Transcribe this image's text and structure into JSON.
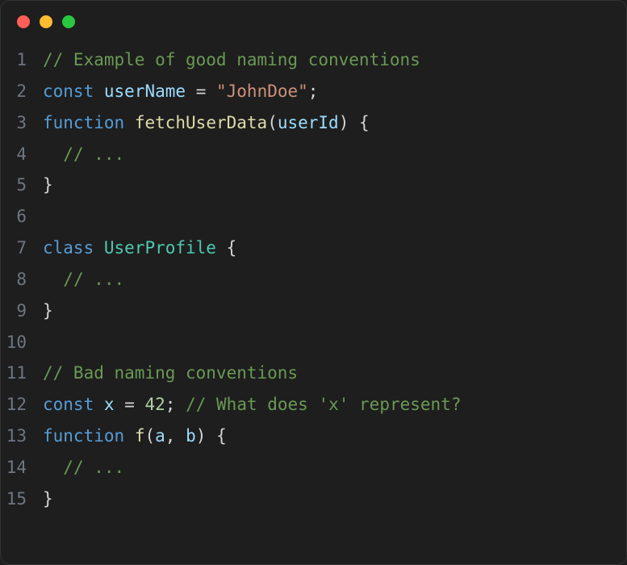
{
  "colors": {
    "background": "#1e1e1e",
    "gutter": "#6e7681",
    "comment": "#6a9955",
    "keyword": "#569cd6",
    "identifier": "#9cdcfe",
    "function": "#dcdcaa",
    "string": "#ce9178",
    "number": "#b5cea8",
    "class": "#4ec9b0",
    "punct": "#d4d4d4",
    "traffic_red": "#ff5f57",
    "traffic_yellow": "#febc2e",
    "traffic_green": "#28c840"
  },
  "lines": [
    {
      "num": "1",
      "tokens": [
        {
          "t": "// Example of good naming conventions",
          "c": "comment"
        }
      ]
    },
    {
      "num": "2",
      "tokens": [
        {
          "t": "const",
          "c": "keyword"
        },
        {
          "t": " ",
          "c": "punct"
        },
        {
          "t": "userName",
          "c": "ident"
        },
        {
          "t": " ",
          "c": "punct"
        },
        {
          "t": "=",
          "c": "operator"
        },
        {
          "t": " ",
          "c": "punct"
        },
        {
          "t": "\"JohnDoe\"",
          "c": "string"
        },
        {
          "t": ";",
          "c": "punct"
        }
      ]
    },
    {
      "num": "3",
      "tokens": [
        {
          "t": "function",
          "c": "keyword"
        },
        {
          "t": " ",
          "c": "punct"
        },
        {
          "t": "fetchUserData",
          "c": "func"
        },
        {
          "t": "(",
          "c": "punct"
        },
        {
          "t": "userId",
          "c": "param"
        },
        {
          "t": ")",
          "c": "punct"
        },
        {
          "t": " ",
          "c": "punct"
        },
        {
          "t": "{",
          "c": "punct"
        }
      ]
    },
    {
      "num": "4",
      "tokens": [
        {
          "t": "  ",
          "c": "punct"
        },
        {
          "t": "// ...",
          "c": "comment"
        }
      ]
    },
    {
      "num": "5",
      "tokens": [
        {
          "t": "}",
          "c": "punct"
        }
      ]
    },
    {
      "num": "6",
      "tokens": []
    },
    {
      "num": "7",
      "tokens": [
        {
          "t": "class",
          "c": "keyword"
        },
        {
          "t": " ",
          "c": "punct"
        },
        {
          "t": "UserProfile",
          "c": "class"
        },
        {
          "t": " ",
          "c": "punct"
        },
        {
          "t": "{",
          "c": "punct"
        }
      ]
    },
    {
      "num": "8",
      "tokens": [
        {
          "t": "  ",
          "c": "punct"
        },
        {
          "t": "// ...",
          "c": "comment"
        }
      ]
    },
    {
      "num": "9",
      "tokens": [
        {
          "t": "}",
          "c": "punct"
        }
      ]
    },
    {
      "num": "10",
      "tokens": []
    },
    {
      "num": "11",
      "tokens": [
        {
          "t": "// Bad naming conventions",
          "c": "comment"
        }
      ]
    },
    {
      "num": "12",
      "tokens": [
        {
          "t": "const",
          "c": "keyword"
        },
        {
          "t": " ",
          "c": "punct"
        },
        {
          "t": "x",
          "c": "ident"
        },
        {
          "t": " ",
          "c": "punct"
        },
        {
          "t": "=",
          "c": "operator"
        },
        {
          "t": " ",
          "c": "punct"
        },
        {
          "t": "42",
          "c": "number"
        },
        {
          "t": ";",
          "c": "punct"
        },
        {
          "t": " ",
          "c": "punct"
        },
        {
          "t": "// What does 'x' represent?",
          "c": "comment"
        }
      ]
    },
    {
      "num": "13",
      "tokens": [
        {
          "t": "function",
          "c": "keyword"
        },
        {
          "t": " ",
          "c": "punct"
        },
        {
          "t": "f",
          "c": "func"
        },
        {
          "t": "(",
          "c": "punct"
        },
        {
          "t": "a",
          "c": "param"
        },
        {
          "t": ",",
          "c": "punct"
        },
        {
          "t": " ",
          "c": "punct"
        },
        {
          "t": "b",
          "c": "param"
        },
        {
          "t": ")",
          "c": "punct"
        },
        {
          "t": " ",
          "c": "punct"
        },
        {
          "t": "{",
          "c": "punct"
        }
      ]
    },
    {
      "num": "14",
      "tokens": [
        {
          "t": "  ",
          "c": "punct"
        },
        {
          "t": "// ...",
          "c": "comment"
        }
      ]
    },
    {
      "num": "15",
      "tokens": [
        {
          "t": "}",
          "c": "punct"
        }
      ]
    }
  ]
}
